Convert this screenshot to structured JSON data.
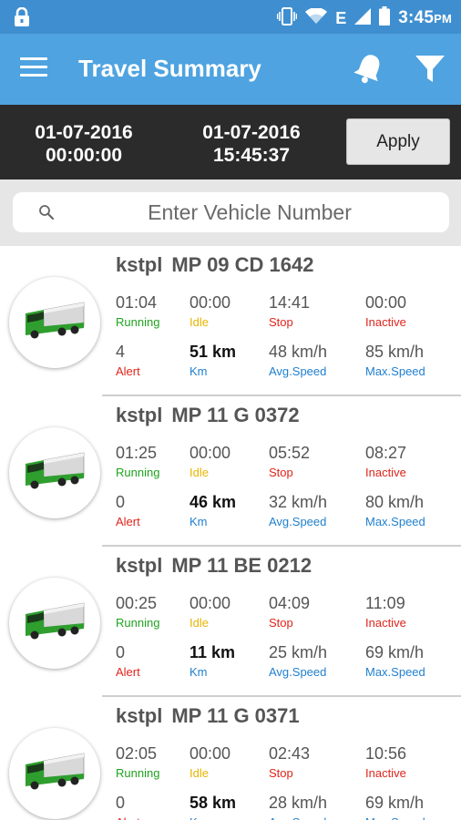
{
  "status_bar": {
    "time": "3:45",
    "ampm": "PM",
    "network": "E"
  },
  "app_bar": {
    "title": "Travel Summary"
  },
  "date_range": {
    "from_date": "01-07-2016",
    "from_time": "00:00:00",
    "to_date": "01-07-2016",
    "to_time": "15:45:37",
    "apply_label": "Apply"
  },
  "search": {
    "placeholder": "Enter Vehicle Number"
  },
  "labels": {
    "running": "Running",
    "idle": "Idle",
    "stop": "Stop",
    "inactive": "Inactive",
    "alert": "Alert",
    "km": "Km",
    "avg_speed": "Avg.Speed",
    "max_speed": "Max.Speed"
  },
  "vehicles": [
    {
      "owner": "kstpl",
      "number": "MP 09 CD 1642",
      "running": "01:04",
      "idle": "00:00",
      "stop": "14:41",
      "inactive": "00:00",
      "alert": "4",
      "km": "51 km",
      "avg_speed": "48 km/h",
      "max_speed": "85 km/h"
    },
    {
      "owner": "kstpl",
      "number": "MP 11 G 0372",
      "running": "01:25",
      "idle": "00:00",
      "stop": "05:52",
      "inactive": "08:27",
      "alert": "0",
      "km": "46 km",
      "avg_speed": "32 km/h",
      "max_speed": "80 km/h"
    },
    {
      "owner": "kstpl",
      "number": "MP 11 BE 0212",
      "running": "00:25",
      "idle": "00:00",
      "stop": "04:09",
      "inactive": "11:09",
      "alert": "0",
      "km": "11 km",
      "avg_speed": "25 km/h",
      "max_speed": "69 km/h"
    },
    {
      "owner": "kstpl",
      "number": "MP 11 G 0371",
      "running": "02:05",
      "idle": "00:00",
      "stop": "02:43",
      "inactive": "10:56",
      "alert": "0",
      "km": "58 km",
      "avg_speed": "28 km/h",
      "max_speed": "69 km/h"
    }
  ],
  "icons": {
    "status_left": "lock-icon",
    "status_right": [
      "vibrate-icon",
      "wifi-icon",
      "signal-icon",
      "battery-icon"
    ],
    "app_bar": [
      "menu-icon",
      "bell-icon",
      "filter-icon"
    ],
    "search": "search-icon",
    "vehicle": "truck-icon"
  },
  "colors": {
    "status_bar": "#3f8fd0",
    "app_bar": "#4ea3e0",
    "date_bar": "#2b2b2b",
    "running": "#1fa31f",
    "idle": "#e8b400",
    "stop": "#e0241b",
    "info": "#1f7fcf",
    "truck": "#2e9e2e"
  }
}
